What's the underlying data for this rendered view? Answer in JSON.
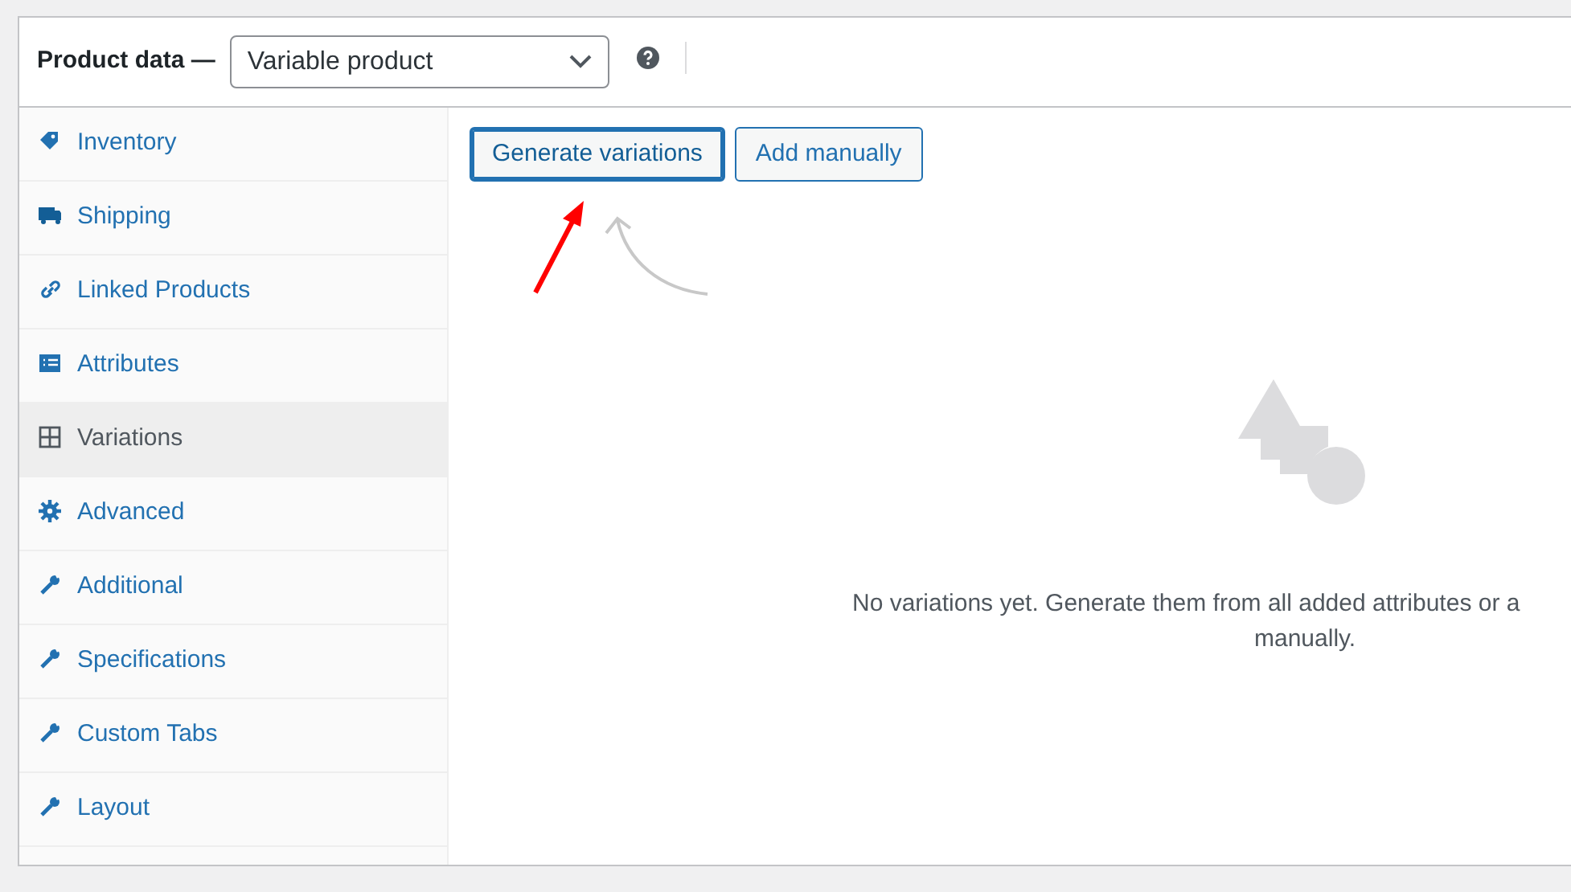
{
  "header": {
    "title": "Product data —",
    "product_type": "Variable product"
  },
  "sidebar": {
    "items": [
      {
        "label": "Inventory",
        "kind": "tag",
        "selected": false
      },
      {
        "label": "Shipping",
        "kind": "truck",
        "selected": false
      },
      {
        "label": "Linked Products",
        "kind": "link",
        "selected": false
      },
      {
        "label": "Attributes",
        "kind": "list",
        "selected": false
      },
      {
        "label": "Variations",
        "kind": "grid",
        "selected": true
      },
      {
        "label": "Advanced",
        "kind": "gear",
        "selected": false
      },
      {
        "label": "Additional",
        "kind": "wrench",
        "selected": false
      },
      {
        "label": "Specifications",
        "kind": "wrench",
        "selected": false
      },
      {
        "label": "Custom Tabs",
        "kind": "wrench",
        "selected": false
      },
      {
        "label": "Layout",
        "kind": "wrench",
        "selected": false
      }
    ]
  },
  "buttons": [
    {
      "label": "Generate variations",
      "selected": true
    },
    {
      "label": "Add manually",
      "selected": false
    }
  ],
  "empty_message": [
    "No variations yet. Generate them from all added attributes or a",
    "manually."
  ]
}
